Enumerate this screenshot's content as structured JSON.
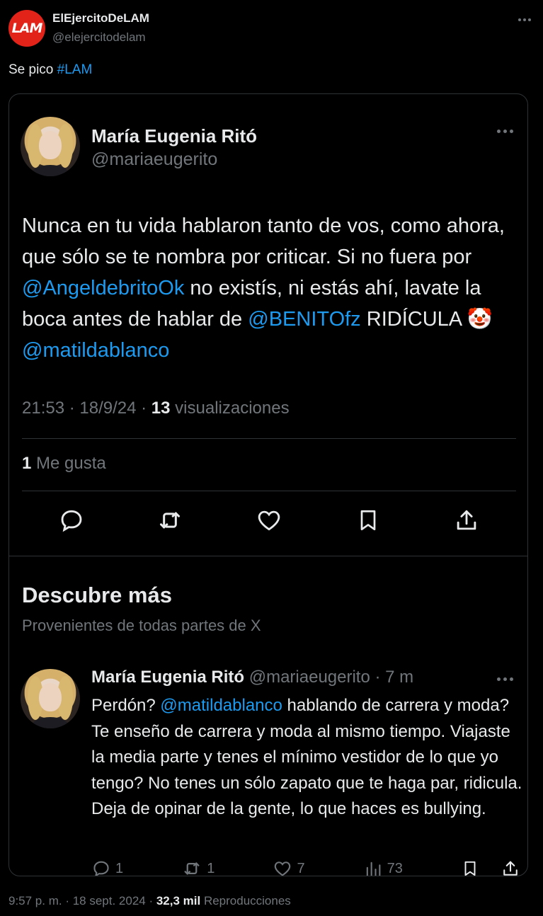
{
  "outer": {
    "logo_text": "LAM",
    "name": "ElEjercitoDeLAM",
    "handle": "@elejercitodelam",
    "text_plain": "Se pico ",
    "hashtag": "#LAM",
    "footer_time": "9:57 p. m. · 18 sept. 2024 · ",
    "footer_views": "32,3 mil",
    "footer_views_label": " Reproducciones"
  },
  "quoted": {
    "name": "María Eugenia Ritó",
    "handle": "@mariaeugerito",
    "text_1": "Nunca en tu vida hablaron tanto de vos, como ahora, que sólo se te nombra por criticar. Si no fuera por ",
    "mention_1": "@AngeldebritoOk",
    "text_2": " no existís, ni estás ahí, lavate la boca antes de hablar de ",
    "mention_2": "@BENITOfz",
    "text_3": " RIDÍCULA ",
    "emoji": "🤡",
    "text_4": " ",
    "mention_3": "@matildablanco",
    "meta_time": "21:53 · 18/9/24 · ",
    "meta_views": "13",
    "meta_views_label": " visualizaciones",
    "likes_count": "1",
    "likes_label": " Me gusta",
    "actions": [
      "reply-icon",
      "retweet-icon",
      "like-icon",
      "bookmark-icon",
      "share-icon"
    ]
  },
  "discover": {
    "title": "Descubre más",
    "subtitle": "Provenientes de todas partes de X"
  },
  "related": {
    "name": "María Eugenia Ritó",
    "handle_time": " @mariaeugerito · 7 m",
    "text_1": "Perdón? ",
    "mention": "@matildablanco",
    "text_2": " hablando de carrera y moda? Te enseño de carrera y moda al mismo tiempo. Viajaste la media parte y tenes el mínimo vestidor de lo que yo tengo? No tenes un sólo zapato que te haga par, ridicula. Deja de opinar de la gente, lo que haces es bullying.",
    "reply_count": "1",
    "retweet_count": "1",
    "like_count": "7",
    "views_count": "73"
  },
  "colors": {
    "background": "#000000",
    "text": "#e7e9ea",
    "muted": "#71767b",
    "link": "#1d9bf0",
    "border": "#2f3336",
    "logo": "#e2231a"
  }
}
